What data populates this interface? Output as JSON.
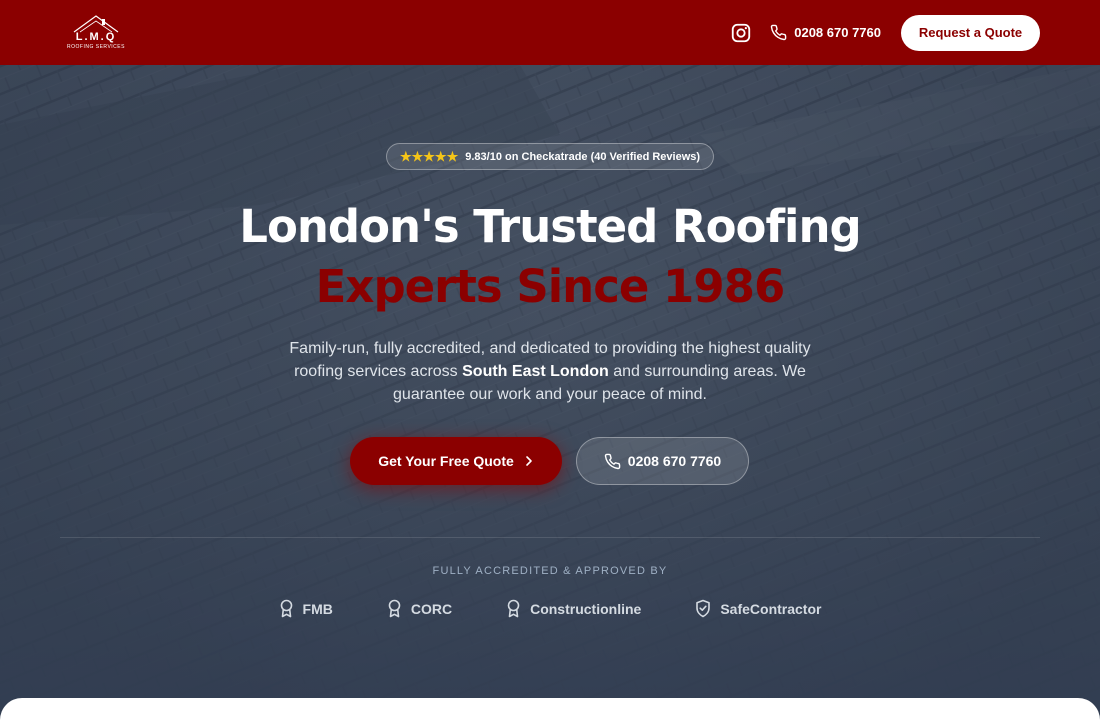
{
  "header": {
    "logo_text": "L.M.Q",
    "logo_subtext": "ROOFING SERVICES",
    "phone": "0208 670 7760",
    "quote_button": "Request a Quote"
  },
  "hero": {
    "rating": {
      "stars": "★★★★★",
      "text": "9.83/10 on Checkatrade (40 Verified Reviews)"
    },
    "headline_line1": "London's Trusted Roofing",
    "headline_line2": "Experts Since 1986",
    "description_part1": "Family-run, fully accredited, and dedicated to providing the highest quality roofing services across ",
    "description_bold": "South East London",
    "description_part2": " and surrounding areas. We guarantee our work and your peace of mind.",
    "cta_primary": "Get Your Free Quote",
    "cta_secondary": "0208 670 7760"
  },
  "accreditations": {
    "title": "FULLY ACCREDITED & APPROVED BY",
    "items": [
      "FMB",
      "CORC",
      "Constructionline",
      "SafeContractor"
    ]
  },
  "colors": {
    "brand_red": "#8b0000",
    "star_yellow": "#f5c518",
    "hero_overlay": "#3a4657"
  },
  "icons": {
    "instagram": "instagram-icon",
    "phone": "phone-icon",
    "arrow": "chevron-right-icon",
    "award": "award-icon",
    "shield": "shield-check-icon"
  }
}
